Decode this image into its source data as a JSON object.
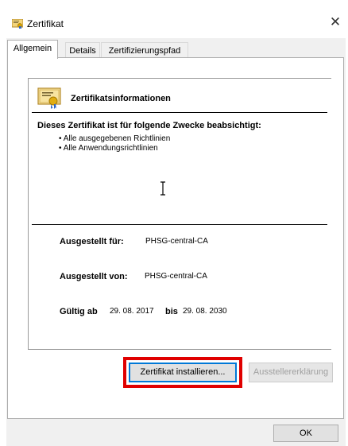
{
  "window": {
    "title": "Zertifikat",
    "close_glyph": "✕"
  },
  "tabs": [
    {
      "label": "Allgemein",
      "active": true
    },
    {
      "label": "Details",
      "active": false
    },
    {
      "label": "Zertifizierungspfad",
      "active": false
    }
  ],
  "cert": {
    "heading": "Zertifikatsinformationen",
    "purpose_heading": "Dieses Zertifikat ist für folgende Zwecke beabsichtigt:",
    "purposes": [
      "• Alle ausgegebenen Richtlinien",
      "• Alle Anwendungsrichtlinien"
    ],
    "issued_to_label": "Ausgestellt für:",
    "issued_to_value": "PHSG-central-CA",
    "issued_by_label": "Ausgestellt von:",
    "issued_by_value": "PHSG-central-CA",
    "valid_from_label": "Gültig ab",
    "valid_from_value": "29. 08. 2017",
    "valid_to_label": "bis",
    "valid_to_value": "29. 08. 2030"
  },
  "buttons": {
    "install": "Zertifikat installieren...",
    "issuer_statement": "Ausstellererklärung",
    "ok": "OK"
  },
  "colors": {
    "highlight": "#e00000",
    "focus_border": "#0078d7",
    "dialog_bg": "#f0f0f0"
  },
  "icons": {
    "title": "certificate-icon",
    "cert": "certificate-icon",
    "cursor": "text-cursor-icon",
    "close": "close-icon"
  }
}
